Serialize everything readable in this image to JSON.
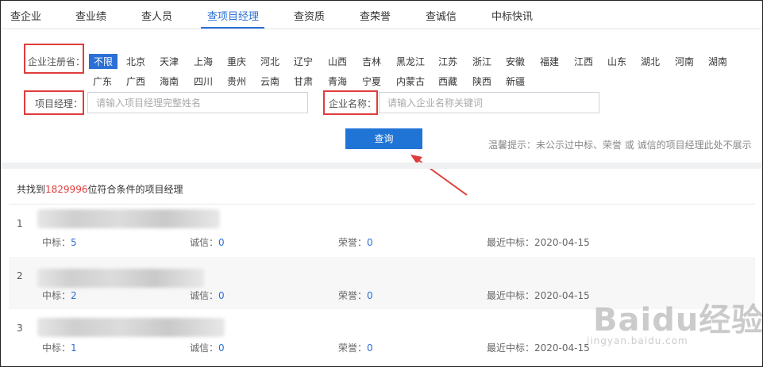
{
  "nav": {
    "tabs": [
      "查企业",
      "查业绩",
      "查人员",
      "查项目经理",
      "查资质",
      "查荣誉",
      "查诚信",
      "中标快讯"
    ],
    "active": "查项目经理"
  },
  "filters": {
    "region_label": "企业注册省：",
    "provinces_row1": [
      "不限",
      "北京",
      "天津",
      "上海",
      "重庆",
      "河北",
      "辽宁",
      "山西",
      "吉林",
      "黑龙江",
      "江苏",
      "浙江",
      "安徽",
      "福建",
      "江西",
      "山东",
      "湖北",
      "河南",
      "湖南"
    ],
    "provinces_row2": [
      "广东",
      "广西",
      "海南",
      "四川",
      "贵州",
      "云南",
      "甘肃",
      "青海",
      "宁夏",
      "内蒙古",
      "西藏",
      "陕西",
      "新疆"
    ],
    "pm_label": "项目经理：",
    "pm_placeholder": "请输入项目经理完整姓名",
    "company_label": "企业名称：",
    "company_placeholder": "请输入企业名称关键词",
    "search_button": "查询",
    "tip": "温馨提示：未公示过中标、荣誉 或 诚信的项目经理此处不展示"
  },
  "results": {
    "prefix": "共找到",
    "count": "1829996",
    "suffix": "位符合条件的项目经理",
    "rows": [
      {
        "index": "1",
        "bid_label": "中标：",
        "bid": "5",
        "credit_label": "诚信：",
        "credit": "0",
        "honor_label": "荣誉：",
        "honor": "0",
        "recent": "最近中标：2020-04-15"
      },
      {
        "index": "2",
        "bid_label": "中标：",
        "bid": "2",
        "credit_label": "诚信：",
        "credit": "0",
        "honor_label": "荣誉：",
        "honor": "0",
        "recent": "最近中标：2020-04-15"
      },
      {
        "index": "3",
        "bid_label": "中标：",
        "bid": "1",
        "credit_label": "诚信：",
        "credit": "0",
        "honor_label": "荣誉：",
        "honor": "0",
        "recent": "最近中标：2020-04-15"
      }
    ]
  },
  "watermark": {
    "brand": "Baidu经验",
    "url": "jingyan.baidu.com"
  },
  "colors": {
    "accent": "#2b6fd6",
    "highlight_box": "#e03c3c",
    "count": "#e23b3b",
    "button": "#1f74d6"
  }
}
